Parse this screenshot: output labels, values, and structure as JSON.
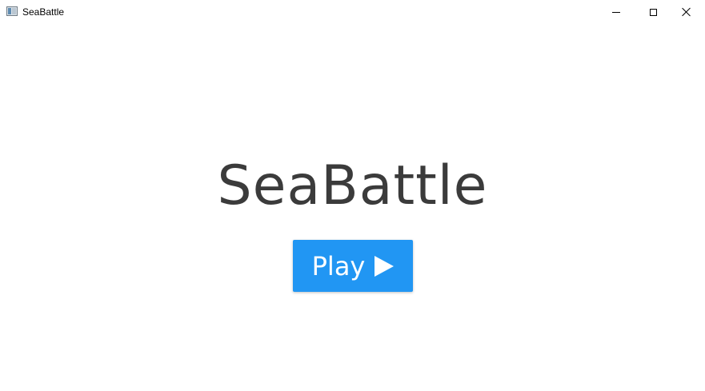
{
  "window": {
    "title": "SeaBattle",
    "controls": [
      "minimize",
      "maximize",
      "close"
    ]
  },
  "main": {
    "title": "SeaBattle",
    "play_button": {
      "label": "Play",
      "icon": "play-icon",
      "color": "#2196f3"
    }
  }
}
